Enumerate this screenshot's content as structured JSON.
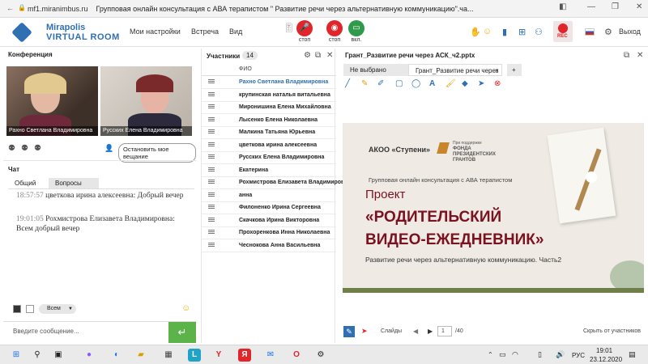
{
  "browser": {
    "url": "mf1.miranimbus.ru",
    "title": "Групповая онлайн консультация с АВА терапистом \" Развитие речи через альтернативную коммуникацию\".ча..."
  },
  "header": {
    "logo_line1": "Mirapolis",
    "logo_line2": "VIRTUAL ROOM",
    "menu": [
      "Мои настройки",
      "Встреча",
      "Вид"
    ],
    "mic_label": "стоп",
    "cam_label": "стоп",
    "screen_label": "вкл.",
    "rec_label": "REC",
    "exit_label": "Выход",
    "colors": {
      "stop": "#e0252b",
      "on": "#2f9a4a",
      "brand": "#2f6fb2"
    }
  },
  "conference": {
    "title": "Конференция",
    "videos": [
      {
        "name": "Рахно Светлана  Владимировна"
      },
      {
        "name": "Русских Елена Владимировна"
      }
    ],
    "stop_button": "Остановить мое вещание"
  },
  "chat": {
    "title": "Чат",
    "tabs": [
      "Общий",
      "Вопросы"
    ],
    "messages": [
      {
        "time": "18:57:57",
        "text": "цветкова  ирина алексеевна: Добрый вечер"
      },
      {
        "time": "19:01:05",
        "text": "Рохмистрова  Елизавета Владимировна: Всем добрый вечер"
      }
    ],
    "recipient": "Всем",
    "placeholder": "Введите сообщение..."
  },
  "participants": {
    "title": "Участники",
    "count": "14",
    "column": "ФИО",
    "rows": [
      "Рахно Светлана  Владимировна",
      "крупинская  наталья витальевна",
      "Миронишина Елена  Михайловна",
      "Лысенко Елена  Николаевна",
      "Малкина Татьяна  Юрьевна",
      "цветкова  ирина алексеевна",
      "Русских Елена Владимировна",
      "Екатерина",
      "Рохмистрова  Елизавета Владимировна",
      "анна",
      "Филоненко Ирина   Сергеевна",
      "Скачкова  Ирина Викторовна",
      "Прохоренкова Инна Николаевна",
      "Чеснокова  Анна  Васильевна"
    ]
  },
  "presentation": {
    "file": "Грант_Развитие речи через АСК_ч2.pptx",
    "tabs": [
      "Не выбрано",
      "Грант_Развитие речи через"
    ],
    "slide": {
      "org": "АКОО «Ступени»",
      "support": "При поддержке",
      "fund": "ФОНДА ПРЕЗИДЕНТСКИХ ГРАНТОВ",
      "subtitle": "Групповая онлайн консультация с АВА терапистом",
      "project": "Проект",
      "headline1": "«РОДИТЕЛЬСКИЙ",
      "headline2": "ВИДЕО-ЕЖЕДНЕВНИК»",
      "topic": "Развитие речи через альтернативную коммуникацию. Часть2"
    },
    "slides_label": "Слайды",
    "page": "1",
    "total": "/40",
    "hide_label": "Скрыть от участников"
  },
  "taskbar": {
    "lang": "РУС",
    "time": "19:01",
    "date": "23.12.2020"
  }
}
